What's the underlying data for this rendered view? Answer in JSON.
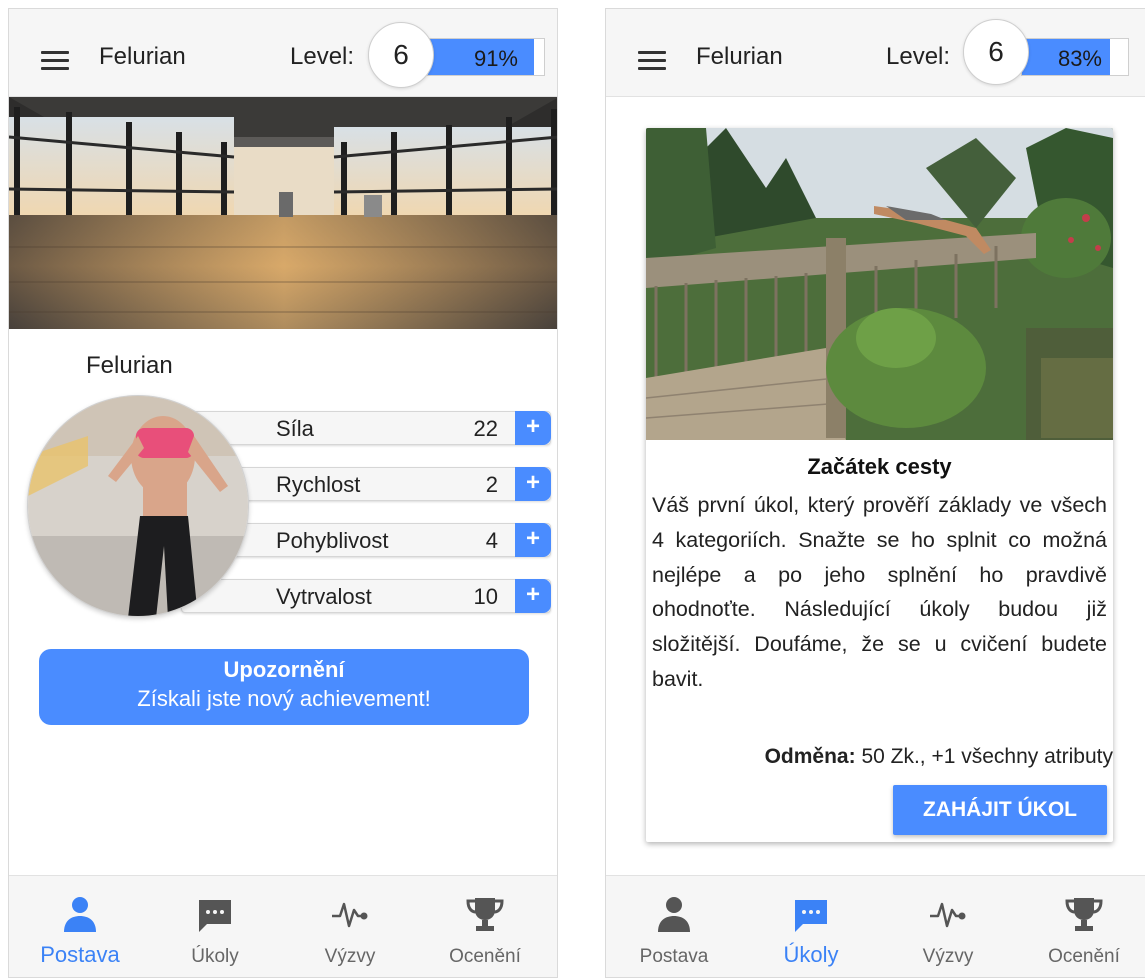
{
  "left": {
    "topbar": {
      "username": "Felurian",
      "level_label": "Level:",
      "level": "6",
      "progress": 0.91,
      "progress_text": "91%"
    },
    "profile_name": "Felurian",
    "stats": [
      {
        "name": "Síla",
        "value": "22"
      },
      {
        "name": "Rychlost",
        "value": "2"
      },
      {
        "name": "Pohyblivost",
        "value": "4"
      },
      {
        "name": "Vytrvalost",
        "value": "10"
      }
    ],
    "plus_label": "+",
    "notice": {
      "title": "Upozornění",
      "text": "Získali jste nový achievement!"
    },
    "active_nav": "Postava"
  },
  "right": {
    "topbar": {
      "username": "Felurian",
      "level_label": "Level:",
      "level": "6",
      "progress": 0.83,
      "progress_text": "83%"
    },
    "quest": {
      "title": "Začátek cesty",
      "description": "Váš první úkol, který prověří základy ve všech 4 kategoriích. Snažte se ho splnit co možná nejlépe a po jeho splnění ho pravdivě ohodnoťte. Následující úkoly budou již složitější. Doufáme, že se u cvičení budete bavit.",
      "reward_label": "Odměna:",
      "reward_value": "50 Zk., +1 všechny atributy",
      "button": "ZAHÁJIT ÚKOL"
    },
    "active_nav": "Úkoly"
  },
  "nav": [
    {
      "label": "Postava",
      "icon": "person-icon"
    },
    {
      "label": "Úkoly",
      "icon": "chat-bubble-icon"
    },
    {
      "label": "Výzvy",
      "icon": "pulse-icon"
    },
    {
      "label": "Ocenění",
      "icon": "trophy-icon"
    }
  ],
  "colors": {
    "accent": "#4a8cff",
    "active_nav": "#3b82f6",
    "bar_bg": "#f6f6f6"
  }
}
